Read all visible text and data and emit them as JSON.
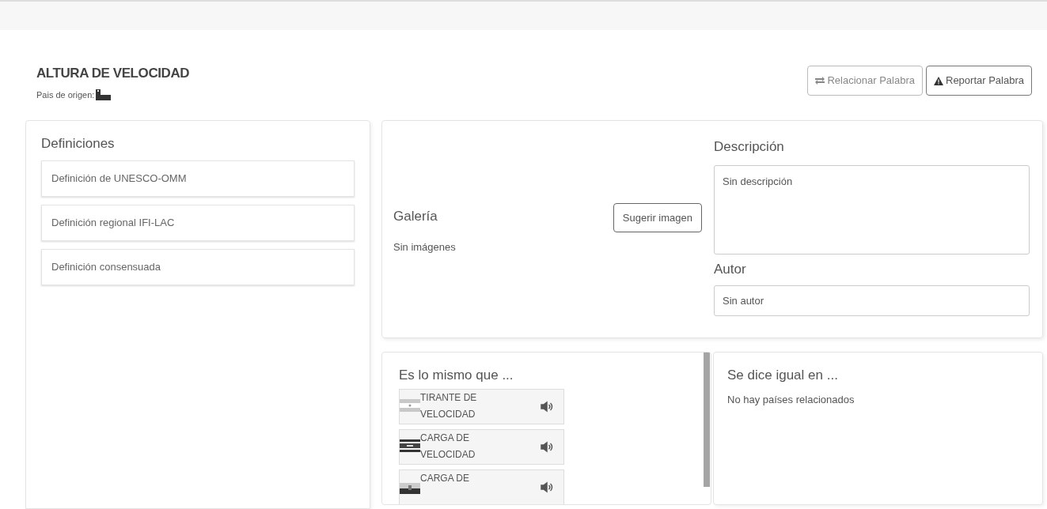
{
  "header": {
    "title": "ALTURA DE VELOCIDAD",
    "origin_label": "Pais de origen:"
  },
  "buttons": [
    {
      "kind": "relate",
      "label": "Relacionar Palabra"
    },
    {
      "kind": "report",
      "label": "Reportar Palabra"
    }
  ],
  "definitions": {
    "title": "Definiciones",
    "items": [
      "Definición de UNESCO-OMM",
      "Definición regional IFI-LAC",
      "Definición consensuada"
    ]
  },
  "gallery": {
    "title": "Galería",
    "empty_text": "Sin imágenes",
    "suggest_button": "Sugerir imagen"
  },
  "description": {
    "title": "Descripción",
    "value": "Sin descripción"
  },
  "author": {
    "title": "Autor",
    "value": "Sin autor"
  },
  "synonyms": {
    "title": "Es lo mismo que ...",
    "items": [
      {
        "lines": [
          "TIRANTE DE",
          "VELOCIDAD"
        ]
      },
      {
        "lines": [
          "CARGA DE",
          "VELOCIDAD"
        ]
      },
      {
        "lines": [
          "CARGA DE"
        ]
      }
    ]
  },
  "countries": {
    "title": "Se dice igual en ...",
    "empty_text": "No hay países relacionados"
  }
}
